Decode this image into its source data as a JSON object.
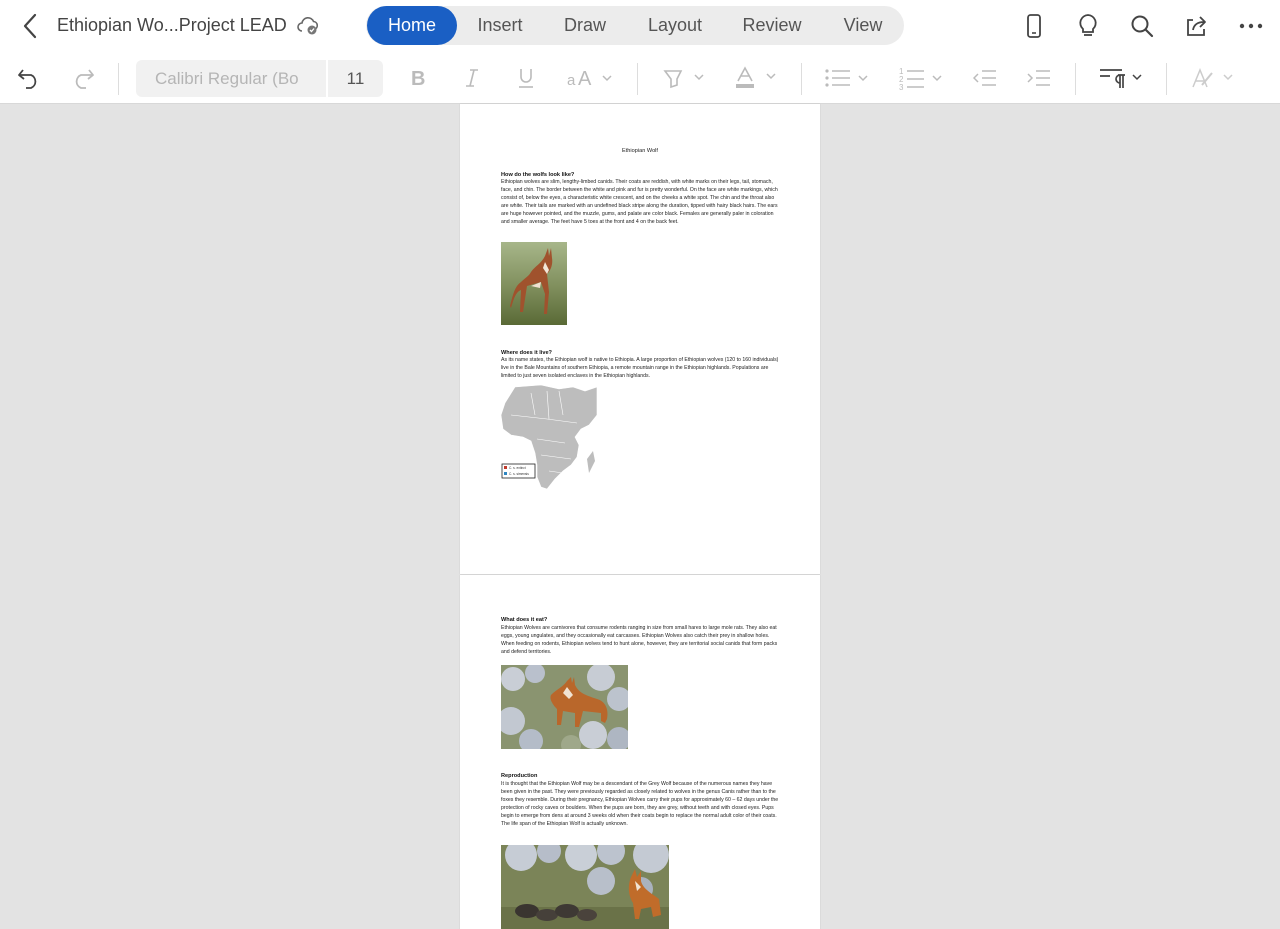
{
  "header": {
    "doc_title": "Ethiopian Wo...Project LEAD",
    "tabs": [
      {
        "label": "Home"
      },
      {
        "label": "Insert"
      },
      {
        "label": "Draw"
      },
      {
        "label": "Layout"
      },
      {
        "label": "Review"
      },
      {
        "label": "View"
      }
    ],
    "active_tab": "Home"
  },
  "ribbon": {
    "font_name": "Calibri Regular (Bo",
    "font_size": "11"
  },
  "document": {
    "title": "Ethiopian Wolf",
    "sections": [
      {
        "heading": "How do the wolfs look like?",
        "body": "Ethiopian wolves are slim, lengthy-limbed canids. Their coats are reddish, with white marks on their legs, tail, stomach, face, and chin. The border between the white and pink and fur is pretty wonderful. On the face are white markings, which consist of, below the eyes, a characteristic white crescent, and on the cheeks a white spot. The chin and the throat also are white. Their tails are marked with an undefined black stripe along the duration, tipped with hairy black hairs. The ears are huge however pointed, and the muzzle, gums, and palate are color black. Females are generally paler in coloration and smaller average. The feet have 5 toes at the front and 4 on the back feet."
      },
      {
        "heading": "Where does it live?",
        "body": "As its name states, the Ethiopian wolf is native to Ethiopia. A large proportion of Ethiopian wolves (120 to 160 individuals) live in the Bale Mountains of southern Ethiopia, a remote mountain range in the Ethiopian highlands. Populations are limited to just seven isolated enclaves in the Ethiopian highlands."
      },
      {
        "heading": "What does it eat?",
        "body": "Ethiopian Wolves are carnivores that consume rodents ranging in size from small hares to large mole rats. They also eat eggs, young ungulates, and they occasionally eat carcasses. Ethiopian Wolves also catch their prey in shallow holes. When feeding on rodents, Ethiopian wolves tend to hunt alone, however, they are territorial social canids that form packs and defend territories."
      },
      {
        "heading": "Reproduction",
        "body": "It is thought that the Ethiopian Wolf may be a descendant of the Grey Wolf because of the numerous names they have been given in the past. They were previously regarded as closely related to wolves in the genus Canis rather than to the foxes they resemble. During their pregnancy, Ethiopian Wolves carry their pups for approximately 60 – 62 days under the protection of rocky caves or boulders. When the pups are born, they are grey, without teeth and with closed eyes. Pups begin to emerge from dens at around 3 weeks old when their coats begin to replace the normal adult color of their coats. The life span of the Ethiopian Wolf is actually unknown."
      }
    ],
    "map_legend": [
      "C. s. extinct",
      "C. s. simensis"
    ]
  },
  "colors": {
    "accent": "#1a5fc4",
    "canvas": "#e3e3e3"
  }
}
